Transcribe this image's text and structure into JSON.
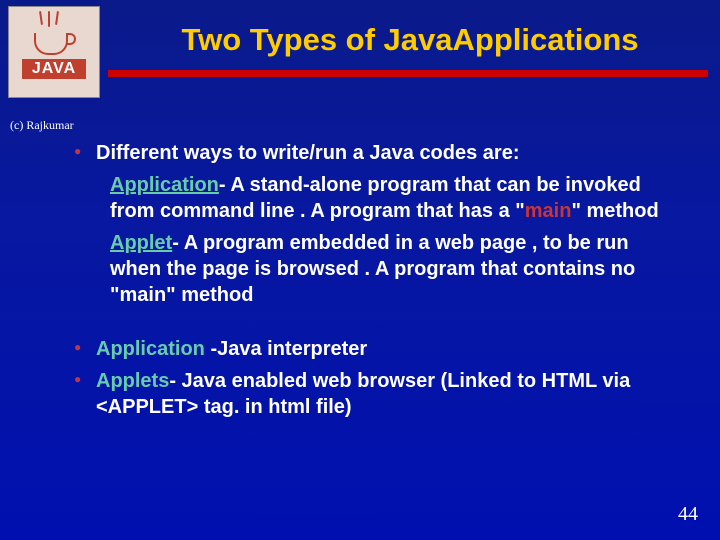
{
  "logo": {
    "text": "JAVA"
  },
  "title": "Two Types of JavaApplications",
  "copyright": "(c) Rajkumar",
  "bullets": {
    "b1": "Different ways to write/run a Java codes are:",
    "app_term": "Application",
    "app_desc": "- A stand-alone program that can be invoked from command line . A program that has a \"",
    "app_main": "main",
    "app_desc_end": "\" method",
    "applet_term": "Applet",
    "applet_desc": "- A program embedded in a web page , to be run when the page is browsed . A program that contains no \"main\" method",
    "b2_term": "Application",
    "b2_rest": " -Java interpreter",
    "b3_term": "Applets",
    "b3_rest": "- Java enabled web browser (Linked to HTML via <APPLET> tag. in html file)"
  },
  "page_number": "44"
}
